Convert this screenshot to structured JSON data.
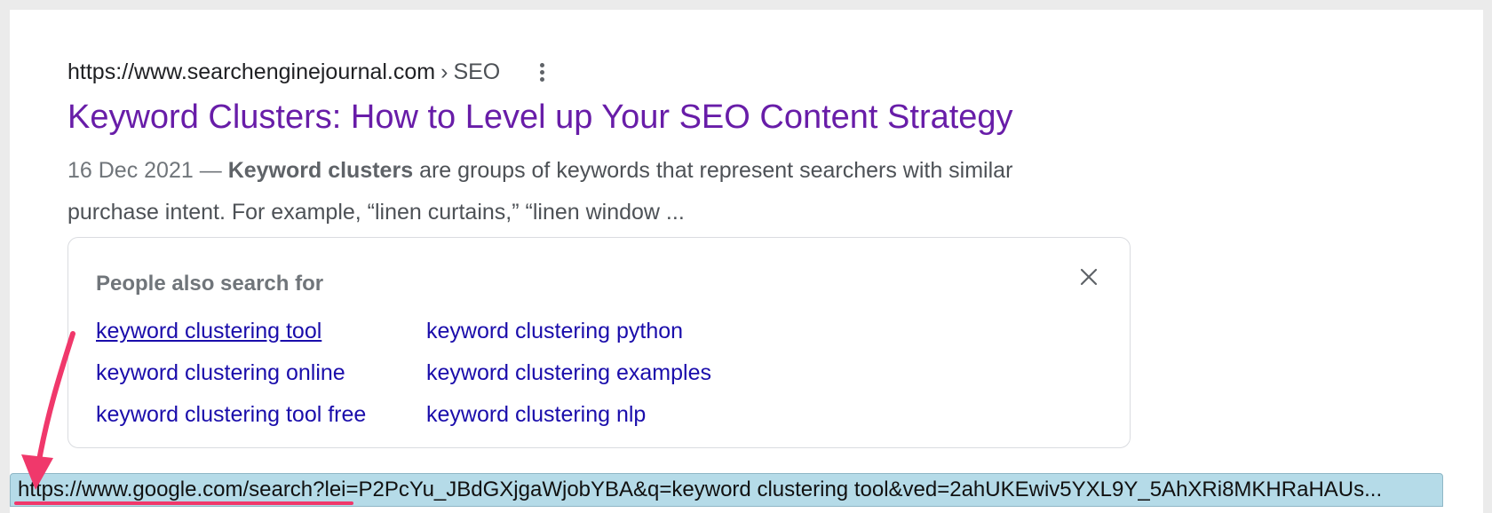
{
  "result": {
    "url": "https://www.searchenginejournal.com",
    "separator": "›",
    "breadcrumb": "SEO",
    "title": "Keyword Clusters: How to Level up Your SEO Content Strategy",
    "date": "16 Dec 2021",
    "dash": "—",
    "snippet_bold": "Keyword clusters",
    "snippet_line1_rest": "are groups of keywords that represent searchers with similar",
    "snippet_line2": "purchase intent. For example, “linen curtains,” “linen window ..."
  },
  "people_also_search": {
    "title": "People also search for",
    "links": [
      "keyword clustering tool",
      "keyword clustering python",
      "keyword clustering online",
      "keyword clustering examples",
      "keyword clustering tool free",
      "keyword clustering nlp"
    ]
  },
  "status_bar": {
    "url": "https://www.google.com/search?lei=P2PcYu_JBdGXjgaWjobYBA&q=keyword clustering tool&ved=2ahUKEwiv5YXL9Y_5AhXRi8MKHRaHAUs..."
  },
  "icons": {
    "more": "more-vert-icon",
    "close": "close-icon",
    "annotation": "arrow-annotation"
  },
  "colors": {
    "visited_title": "#681da8",
    "link": "#1a0dab",
    "annotation": "#f0386b",
    "status_bar_bg": "#b5dbe8"
  }
}
